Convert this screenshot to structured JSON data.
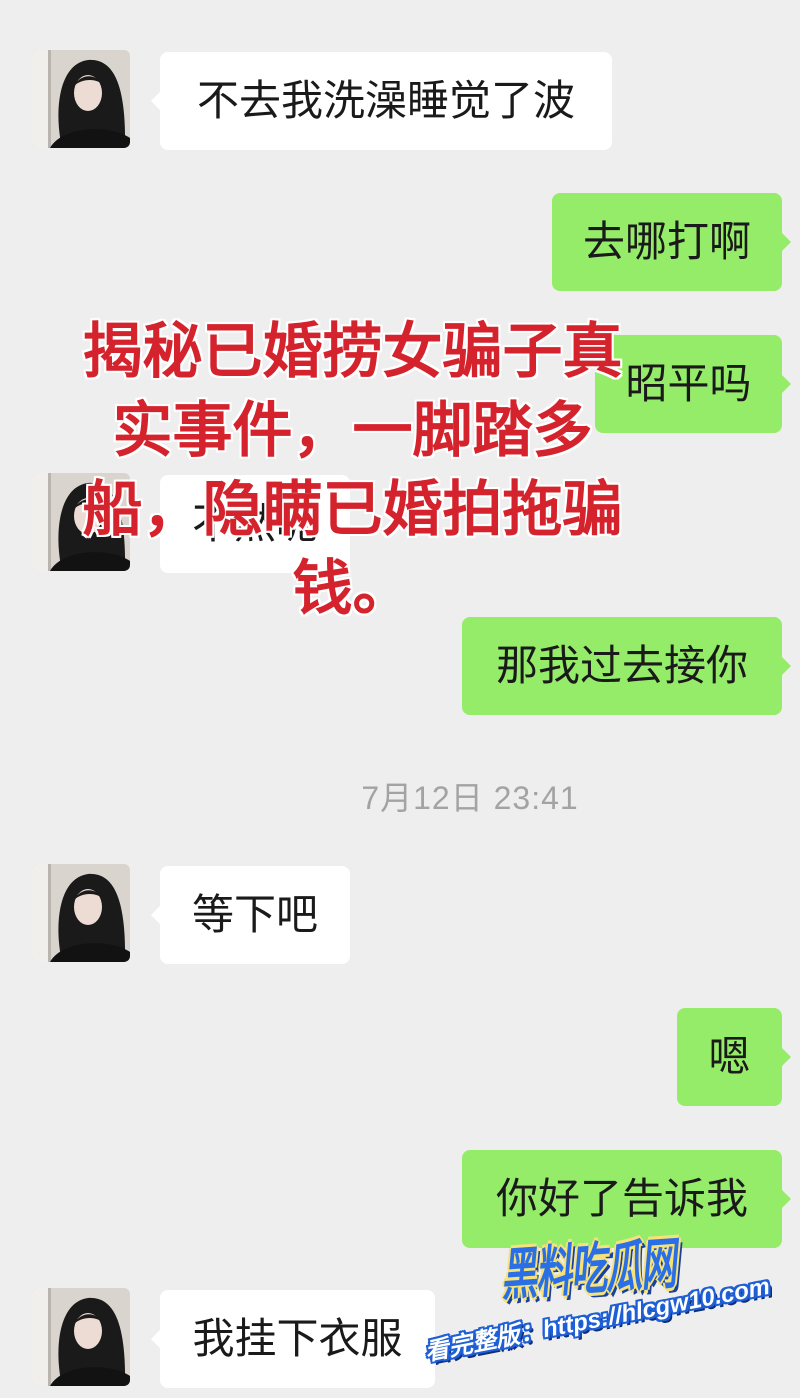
{
  "colors": {
    "background": "#eeeeee",
    "incoming_bubble": "#ffffff",
    "outgoing_bubble": "#95ec69",
    "timestamp_text": "#a3a3a3",
    "overlay_text": "#d4232c",
    "watermark_blue": "#2a6fe6"
  },
  "messages": [
    {
      "incoming": true,
      "avatar": "avatar-icon",
      "text": "不去我洗澡睡觉了波"
    },
    {
      "incoming": false,
      "text": "去哪打啊"
    },
    {
      "incoming": false,
      "text": "昭平吗"
    },
    {
      "incoming": true,
      "avatar": "avatar-icon",
      "text": "不然呢"
    },
    {
      "incoming": false,
      "text": "那我过去接你"
    },
    {
      "incoming": true,
      "avatar": "avatar-icon",
      "text": "等下吧"
    },
    {
      "incoming": false,
      "text": "嗯"
    },
    {
      "incoming": false,
      "text": "你好了告诉我"
    },
    {
      "incoming": true,
      "avatar": "avatar-icon",
      "text": "我挂下衣服"
    }
  ],
  "timestamp": "7月12日 23:41",
  "overlay": {
    "lines": [
      "揭秘已婚捞女骗子真",
      "实事件，一脚踏多",
      "船，隐瞒已婚拍拖骗",
      "钱。"
    ]
  },
  "watermark": {
    "site_name": "黑料吃瓜网",
    "link_text": "看完整版：https://hlcgw10.com"
  }
}
